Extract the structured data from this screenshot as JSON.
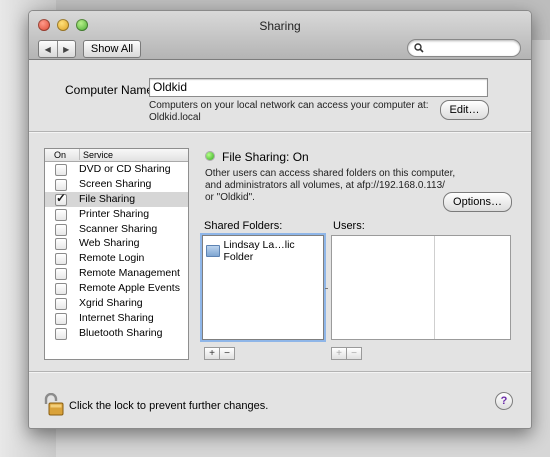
{
  "window": {
    "title": "Sharing"
  },
  "toolbar": {
    "back_icon": "◀",
    "forward_icon": "▶",
    "show_all_label": "Show All",
    "search_placeholder": ""
  },
  "computer_name": {
    "label": "Computer Name:",
    "value": "Oldkid",
    "description_line1": "Computers on your local network can access your computer at:",
    "description_line2": "Oldkid.local",
    "edit_label": "Edit…"
  },
  "services": {
    "header_on": "On",
    "header_service": "Service",
    "items": [
      {
        "name": "DVD or CD Sharing",
        "checked": false,
        "selected": false
      },
      {
        "name": "Screen Sharing",
        "checked": false,
        "selected": false
      },
      {
        "name": "File Sharing",
        "checked": true,
        "selected": true
      },
      {
        "name": "Printer Sharing",
        "checked": false,
        "selected": false
      },
      {
        "name": "Scanner Sharing",
        "checked": false,
        "selected": false
      },
      {
        "name": "Web Sharing",
        "checked": false,
        "selected": false
      },
      {
        "name": "Remote Login",
        "checked": false,
        "selected": false
      },
      {
        "name": "Remote Management",
        "checked": false,
        "selected": false
      },
      {
        "name": "Remote Apple Events",
        "checked": false,
        "selected": false
      },
      {
        "name": "Xgrid Sharing",
        "checked": false,
        "selected": false
      },
      {
        "name": "Internet Sharing",
        "checked": false,
        "selected": false
      },
      {
        "name": "Bluetooth Sharing",
        "checked": false,
        "selected": false
      }
    ]
  },
  "detail": {
    "status": "File Sharing: On",
    "info_line1": "Other users can access shared folders on this computer,",
    "info_line2": "and administrators all volumes, at afp://192.168.0.113/",
    "info_line3": "or \"Oldkid\".",
    "options_label": "Options…",
    "shared_folders_label": "Shared Folders:",
    "users_label": "Users:",
    "shared_folders": [
      "Lindsay La…lic Folder"
    ],
    "plus": "+",
    "minus": "−"
  },
  "footer": {
    "lock_text": "Click the lock to prevent further changes.",
    "help": "?"
  },
  "colors": {
    "status_green": "#2ea81a",
    "selection_gray": "#d6d6d6",
    "focus_ring": "#8fb6e8"
  }
}
